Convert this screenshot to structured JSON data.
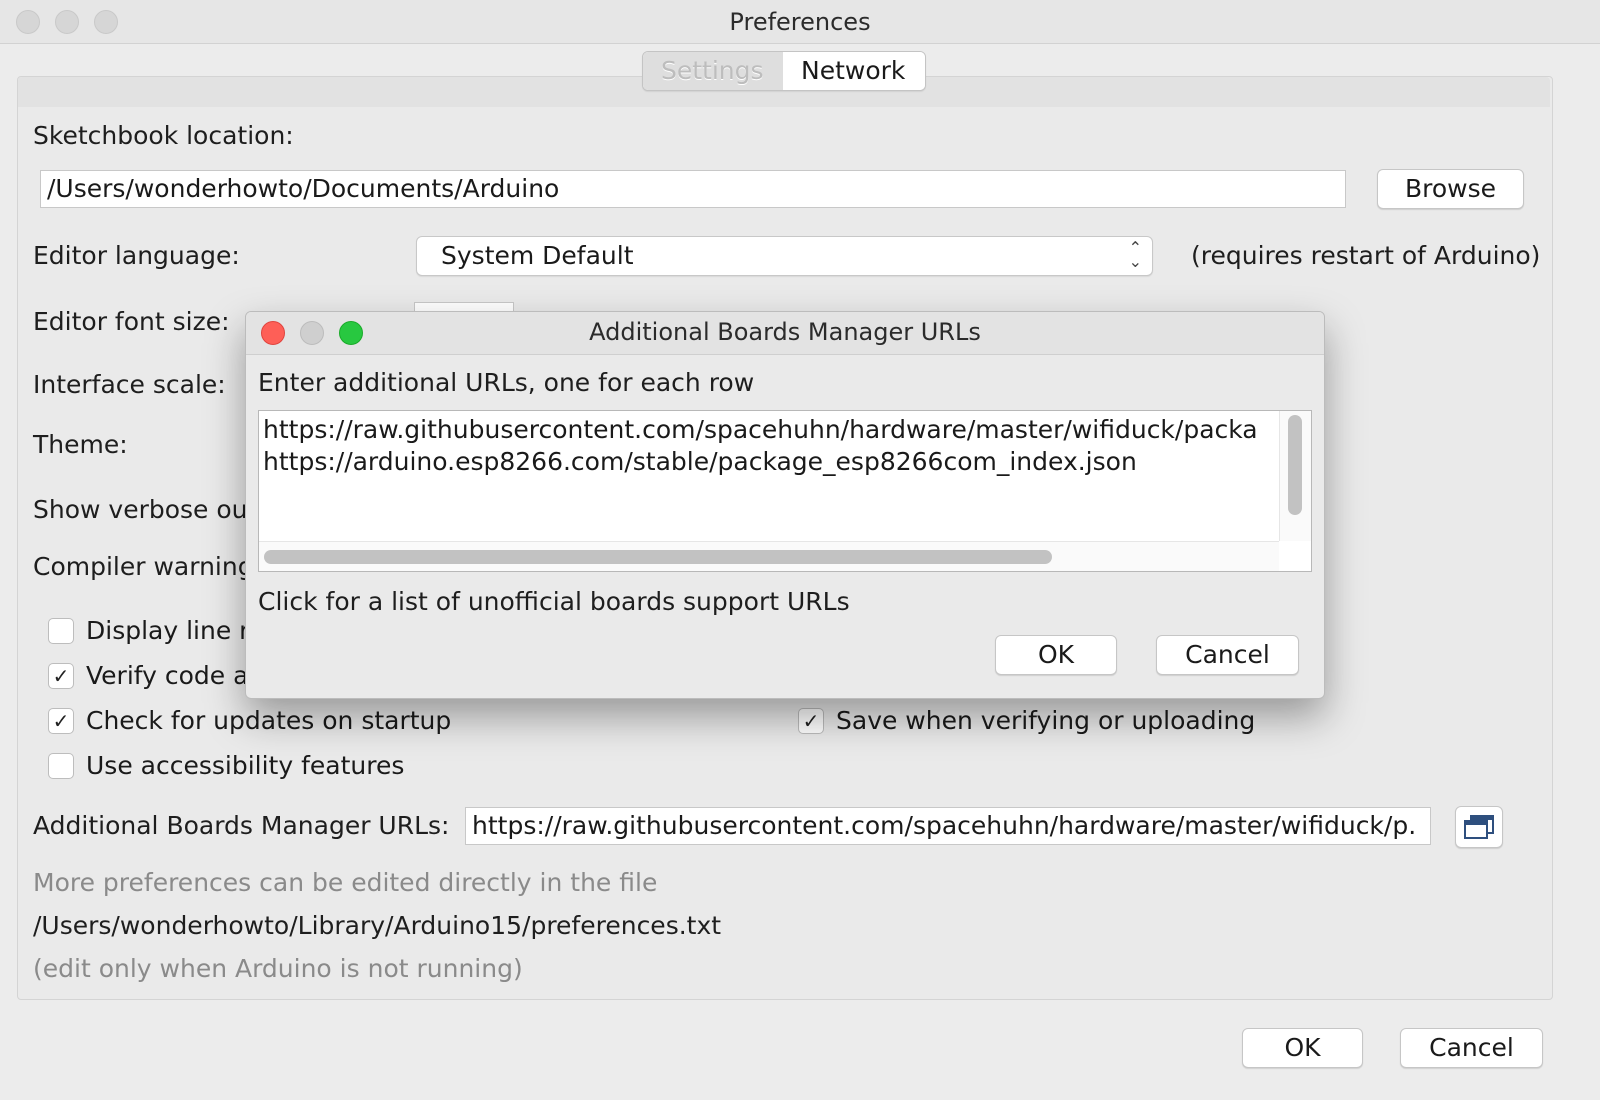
{
  "window": {
    "title": "Preferences"
  },
  "tabs": [
    {
      "label": "Settings",
      "active": false
    },
    {
      "label": "Network",
      "active": true
    }
  ],
  "sketchbook": {
    "label": "Sketchbook location:",
    "value": "/Users/wonderhowto/Documents/Arduino",
    "browse_label": "Browse"
  },
  "editor_language": {
    "label": "Editor language:",
    "selected": "System Default",
    "note": "(requires restart of Arduino)"
  },
  "left_labels": {
    "font_size": "Editor font size:",
    "interface_scale": "Interface scale:",
    "theme": "Theme:",
    "verbose": "Show verbose out",
    "compiler_warnings": "Compiler warning"
  },
  "checkboxes": {
    "display_line": {
      "label": "Display line r",
      "checked": false
    },
    "verify_code": {
      "label": "Verify code a",
      "checked": true
    },
    "check_updates": {
      "label": "Check for updates on startup",
      "checked": true
    },
    "accessibility": {
      "label": "Use accessibility features",
      "checked": false
    },
    "save_verify": {
      "label": "Save when verifying or uploading",
      "checked": true
    }
  },
  "boards_urls": {
    "label": "Additional Boards Manager URLs:",
    "value": "https://raw.githubusercontent.com/spacehuhn/hardware/master/wifiduck/p.",
    "button_icon": "window-list-icon"
  },
  "file_hint": {
    "line1": "More preferences can be edited directly in the file",
    "path": "/Users/wonderhowto/Library/Arduino15/preferences.txt",
    "line3": "(edit only when Arduino is not running)"
  },
  "footer": {
    "ok_label": "OK",
    "cancel_label": "Cancel"
  },
  "dialog": {
    "title": "Additional Boards Manager URLs",
    "instruction": "Enter additional URLs, one for each row",
    "urls": [
      "https://raw.githubusercontent.com/spacehuhn/hardware/master/wifiduck/packa",
      "https://arduino.esp8266.com/stable/package_esp8266com_index.json"
    ],
    "link_text": "Click for a list of unofficial boards support URLs",
    "ok_label": "OK",
    "cancel_label": "Cancel",
    "colors": {
      "close": "#fe5f57",
      "minimize": "#cfcfcf",
      "zoom": "#28c840"
    }
  },
  "check_mark": "✓"
}
